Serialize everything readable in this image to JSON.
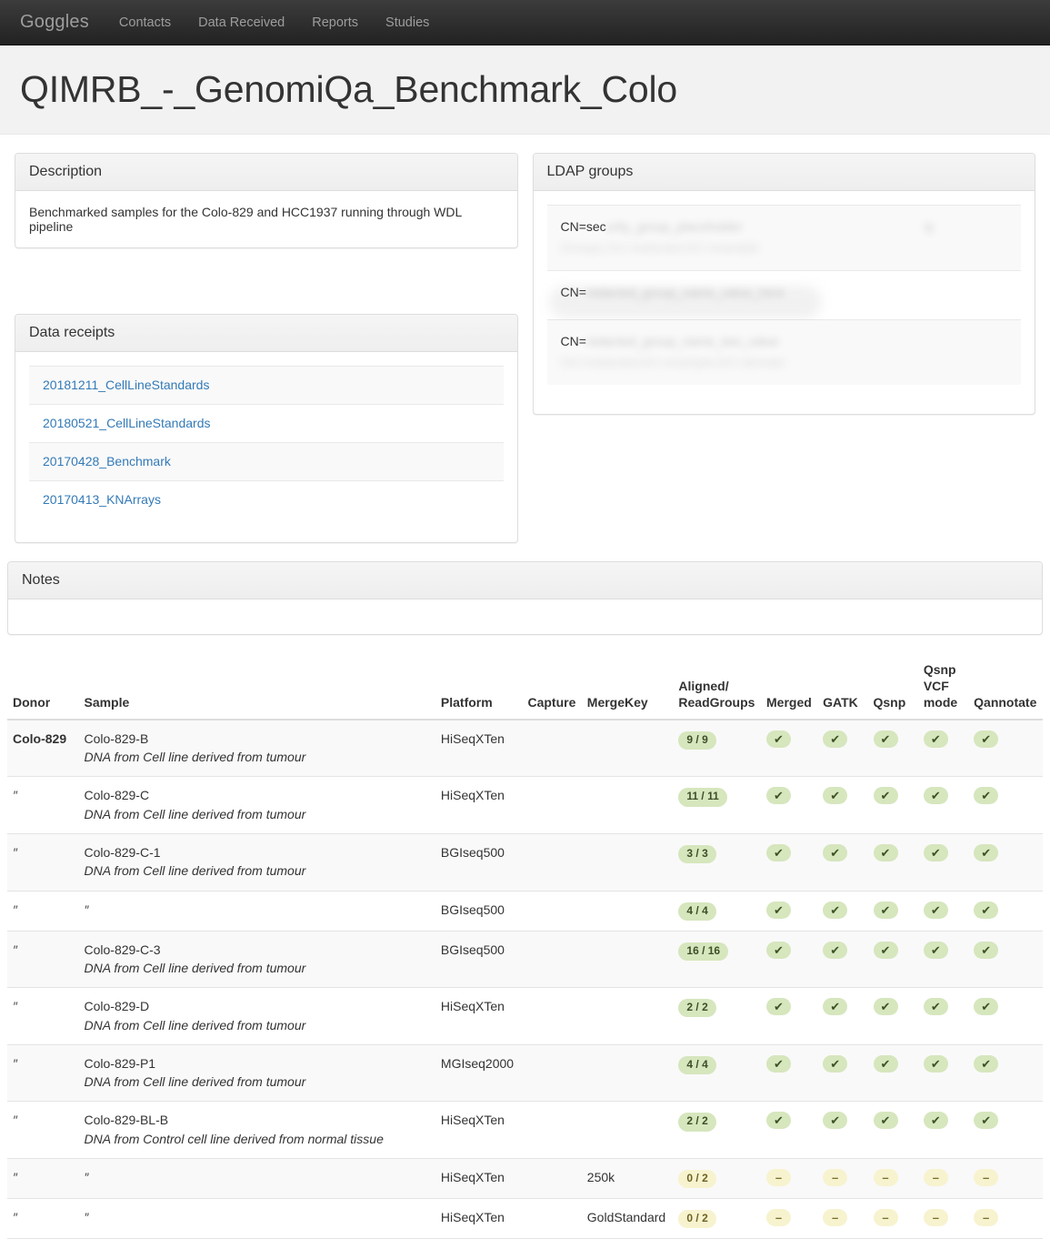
{
  "navbar": {
    "brand": "Goggles",
    "links": [
      {
        "label": "Contacts"
      },
      {
        "label": "Data Received"
      },
      {
        "label": "Reports"
      },
      {
        "label": "Studies"
      }
    ]
  },
  "header": {
    "title": "QIMRB_-_GenomiQa_Benchmark_Colo"
  },
  "description_panel": {
    "title": "Description",
    "text": "Benchmarked samples for the Colo-829 and HCC1937 running through WDL pipeline"
  },
  "ldap_panel": {
    "title": "LDAP groups",
    "items": [
      {
        "prefix": "CN=sec",
        "redacted_tail": "urity_group_placeholder",
        "second_line": "Groups,OU=redacted,DC=example",
        "trailing": "ty"
      },
      {
        "prefix": "CN=",
        "redacted_tail": "redacted_group_name_value_here",
        "second_line": "",
        "trailing": ""
      },
      {
        "prefix": "CN=",
        "redacted_tail": "redacted_group_name_two_value",
        "second_line": "OU=redacted,DC=example,DC=domain",
        "trailing": ""
      }
    ]
  },
  "data_receipts_panel": {
    "title": "Data receipts",
    "items": [
      {
        "label": "20181211_CellLineStandards"
      },
      {
        "label": "20180521_CellLineStandards"
      },
      {
        "label": "20170428_Benchmark"
      },
      {
        "label": "20170413_KNArrays"
      }
    ]
  },
  "notes_panel": {
    "title": "Notes",
    "text": ""
  },
  "table": {
    "columns": [
      {
        "key": "donor",
        "label": "Donor"
      },
      {
        "key": "sample",
        "label": "Sample"
      },
      {
        "key": "platform",
        "label": "Platform"
      },
      {
        "key": "capture",
        "label": "Capture"
      },
      {
        "key": "mergekey",
        "label": "MergeKey"
      },
      {
        "key": "aligned",
        "label": "Aligned/\nReadGroups"
      },
      {
        "key": "merged",
        "label": "Merged"
      },
      {
        "key": "gatk",
        "label": "GATK"
      },
      {
        "key": "qsnp",
        "label": "Qsnp"
      },
      {
        "key": "qsnpvcf",
        "label": "Qsnp\nVCF\nmode"
      },
      {
        "key": "qannotate",
        "label": "Qannotate"
      }
    ],
    "ditto": "″",
    "rows": [
      {
        "donor": "Colo-829",
        "donor_ditto": false,
        "sample": "Colo-829-B",
        "sample_ditto": false,
        "sample_desc": "DNA from Cell line derived from tumour",
        "platform": "HiSeqXTen",
        "capture": "",
        "mergekey": "",
        "aligned": "9 / 9",
        "aligned_state": "ok",
        "merged": "check",
        "gatk": "check",
        "qsnp": "check",
        "qsnpvcf": "check",
        "qannotate": "check",
        "state": "ok"
      },
      {
        "donor": "″",
        "donor_ditto": true,
        "sample": "Colo-829-C",
        "sample_ditto": false,
        "sample_desc": "DNA from Cell line derived from tumour",
        "platform": "HiSeqXTen",
        "capture": "",
        "mergekey": "",
        "aligned": "11 / 11",
        "aligned_state": "ok",
        "merged": "check",
        "gatk": "check",
        "qsnp": "check",
        "qsnpvcf": "check",
        "qannotate": "check",
        "state": "ok"
      },
      {
        "donor": "″",
        "donor_ditto": true,
        "sample": "Colo-829-C-1",
        "sample_ditto": false,
        "sample_desc": "DNA from Cell line derived from tumour",
        "platform": "BGIseq500",
        "capture": "",
        "mergekey": "",
        "aligned": "3 / 3",
        "aligned_state": "ok",
        "merged": "check",
        "gatk": "check",
        "qsnp": "check",
        "qsnpvcf": "check",
        "qannotate": "check",
        "state": "ok"
      },
      {
        "donor": "″",
        "donor_ditto": true,
        "sample": "″",
        "sample_ditto": true,
        "sample_desc": "",
        "platform": "BGIseq500",
        "capture": "",
        "mergekey": "",
        "aligned": "4 / 4",
        "aligned_state": "ok",
        "merged": "check",
        "gatk": "check",
        "qsnp": "check",
        "qsnpvcf": "check",
        "qannotate": "check",
        "state": "ok"
      },
      {
        "donor": "″",
        "donor_ditto": true,
        "sample": "Colo-829-C-3",
        "sample_ditto": false,
        "sample_desc": "DNA from Cell line derived from tumour",
        "platform": "BGIseq500",
        "capture": "",
        "mergekey": "",
        "aligned": "16 / 16",
        "aligned_state": "ok",
        "merged": "check",
        "gatk": "check",
        "qsnp": "check",
        "qsnpvcf": "check",
        "qannotate": "check",
        "state": "ok"
      },
      {
        "donor": "″",
        "donor_ditto": true,
        "sample": "Colo-829-D",
        "sample_ditto": false,
        "sample_desc": "DNA from Cell line derived from tumour",
        "platform": "HiSeqXTen",
        "capture": "",
        "mergekey": "",
        "aligned": "2 / 2",
        "aligned_state": "ok",
        "merged": "check",
        "gatk": "check",
        "qsnp": "check",
        "qsnpvcf": "check",
        "qannotate": "check",
        "state": "ok"
      },
      {
        "donor": "″",
        "donor_ditto": true,
        "sample": "Colo-829-P1",
        "sample_ditto": false,
        "sample_desc": "DNA from Cell line derived from tumour",
        "platform": "MGIseq2000",
        "capture": "",
        "mergekey": "",
        "aligned": "4 / 4",
        "aligned_state": "ok",
        "merged": "check",
        "gatk": "check",
        "qsnp": "check",
        "qsnpvcf": "check",
        "qannotate": "check",
        "state": "ok"
      },
      {
        "donor": "″",
        "donor_ditto": true,
        "sample": "Colo-829-BL-B",
        "sample_ditto": false,
        "sample_desc": "DNA from Control cell line derived from normal tissue",
        "platform": "HiSeqXTen",
        "capture": "",
        "mergekey": "",
        "aligned": "2 / 2",
        "aligned_state": "ok",
        "merged": "check",
        "gatk": "check",
        "qsnp": "check",
        "qsnpvcf": "check",
        "qannotate": "check",
        "state": "ok"
      },
      {
        "donor": "″",
        "donor_ditto": true,
        "sample": "″",
        "sample_ditto": true,
        "sample_desc": "",
        "platform": "HiSeqXTen",
        "capture": "",
        "mergekey": "250k",
        "aligned": "0 / 2",
        "aligned_state": "na",
        "merged": "dash",
        "gatk": "dash",
        "qsnp": "dash",
        "qsnpvcf": "dash",
        "qannotate": "dash",
        "state": "na"
      },
      {
        "donor": "″",
        "donor_ditto": true,
        "sample": "″",
        "sample_ditto": true,
        "sample_desc": "",
        "platform": "HiSeqXTen",
        "capture": "",
        "mergekey": "GoldStandard",
        "aligned": "0 / 2",
        "aligned_state": "na",
        "merged": "dash",
        "gatk": "dash",
        "qsnp": "dash",
        "qsnpvcf": "dash",
        "qannotate": "dash",
        "state": "na"
      }
    ]
  },
  "icons": {
    "check": "✔",
    "dash": "–"
  },
  "colors": {
    "navbar_bg": "#222222",
    "nav_link": "#9d9d9d",
    "link": "#337ab7",
    "badge_ok_bg": "#d6e6bd",
    "badge_ok_fg": "#3d4f28",
    "badge_na_bg": "#f7f3cf",
    "badge_na_fg": "#6d6223",
    "panel_border": "#dddddd",
    "jumbotron_bg": "#f2f2f2"
  }
}
